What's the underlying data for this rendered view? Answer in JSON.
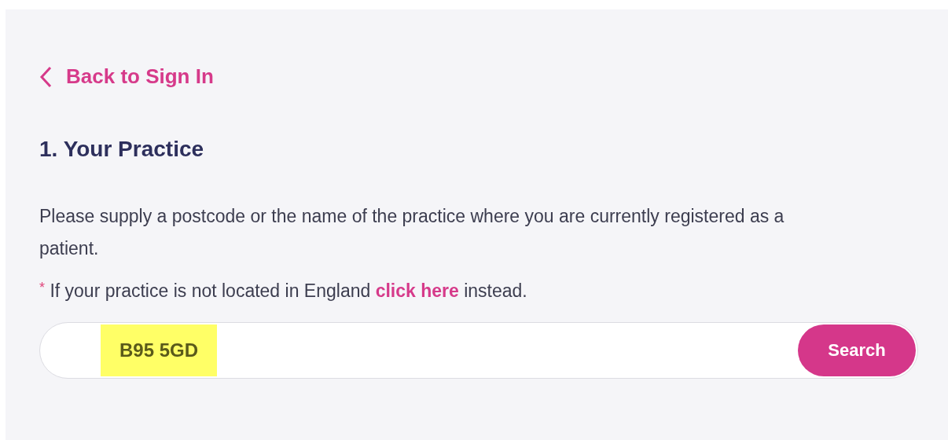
{
  "back_link": {
    "label": "Back to Sign In"
  },
  "heading": "1. Your Practice",
  "description": "Please supply a postcode or the name of the practice where you are currently registered as a patient.",
  "note": {
    "marker": "*",
    "before": "If your practice is not located in England",
    "link": "click here",
    "after": "instead."
  },
  "search": {
    "value": "B95 5GD",
    "highlighted": true,
    "button": "Search"
  }
}
